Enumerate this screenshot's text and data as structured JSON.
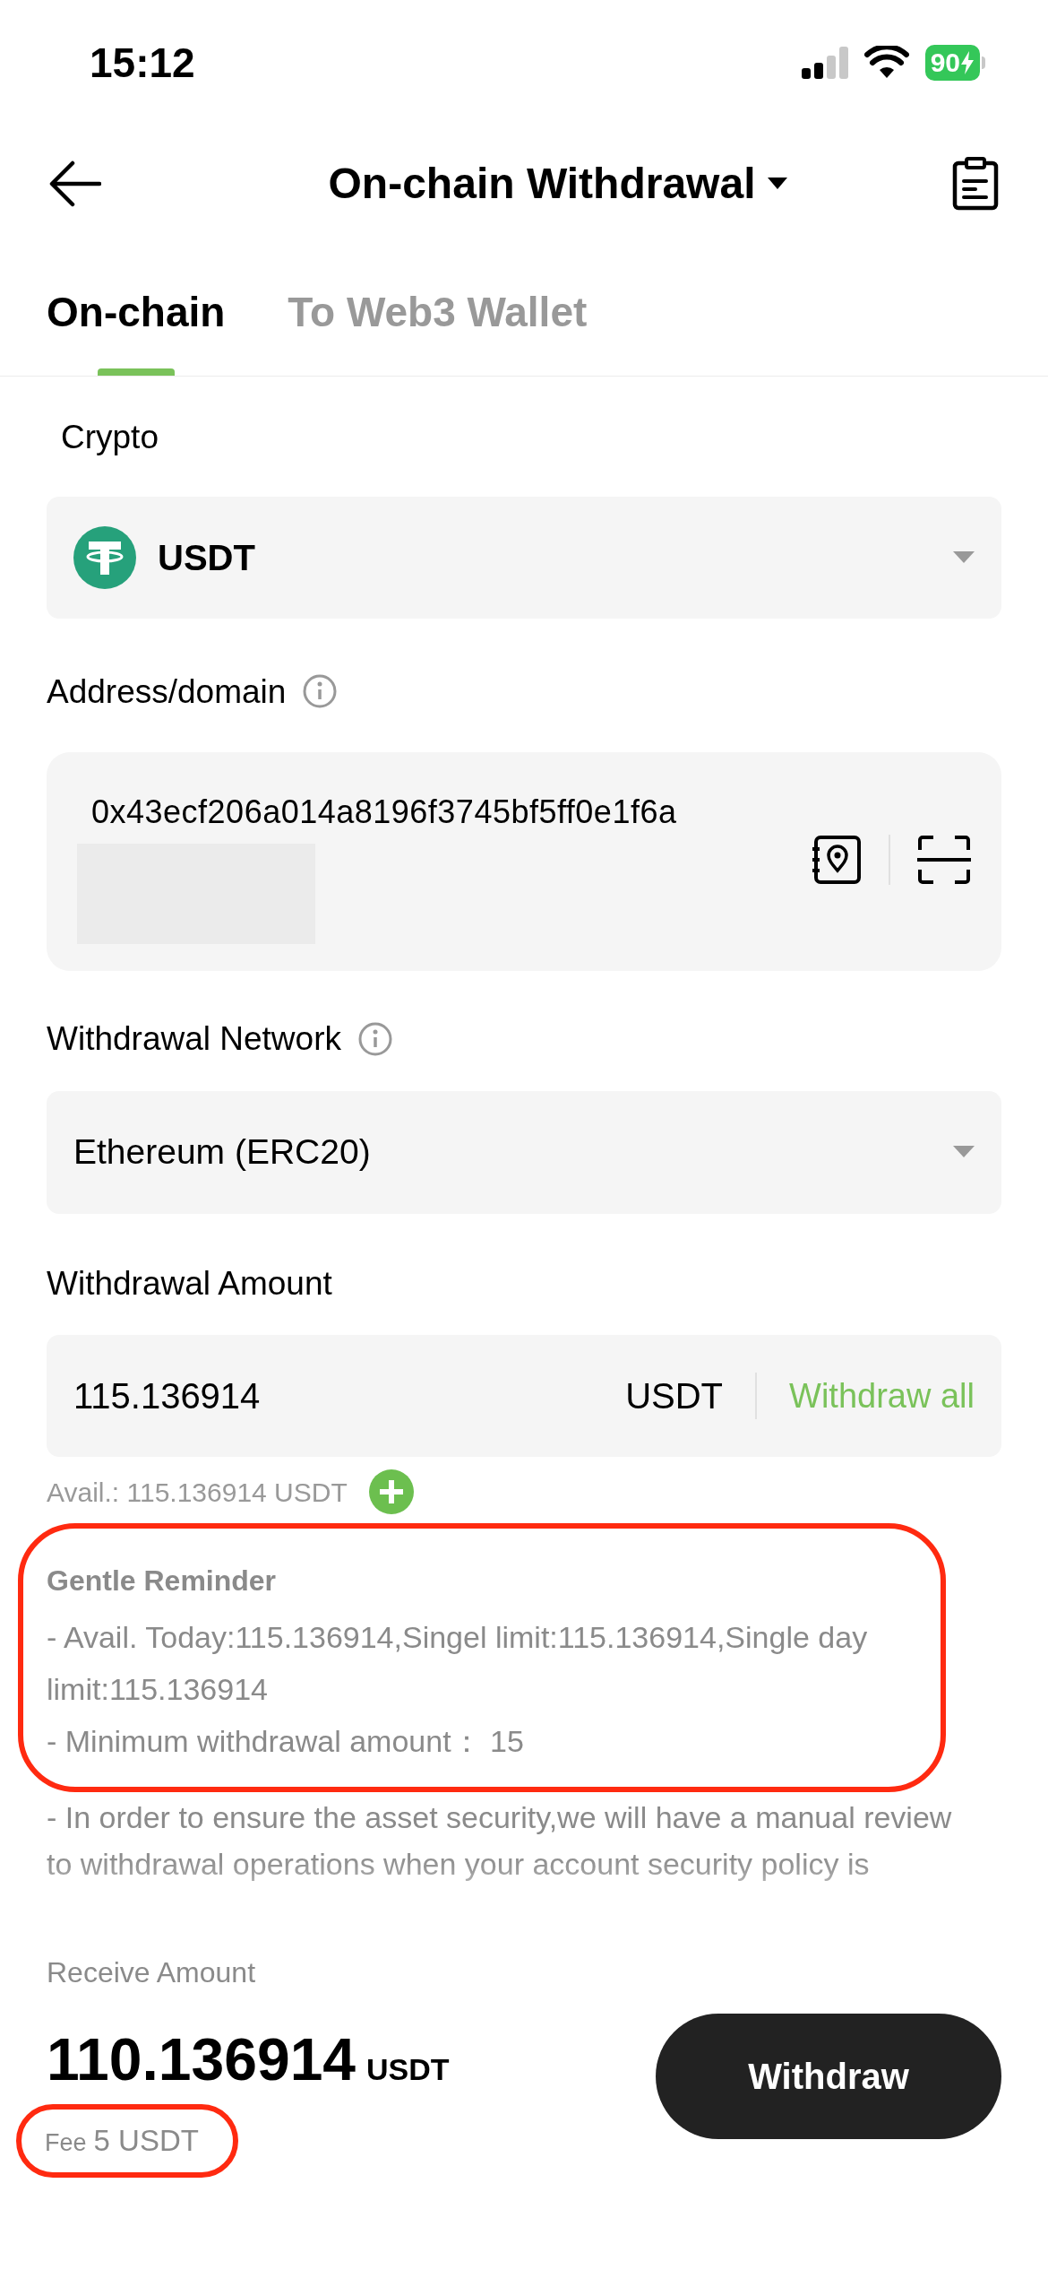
{
  "status_bar": {
    "time": "15:12",
    "battery": "90"
  },
  "header": {
    "title": "On-chain Withdrawal"
  },
  "tabs": [
    {
      "label": "On-chain",
      "selected": true
    },
    {
      "label": "To Web3 Wallet",
      "selected": false
    }
  ],
  "crypto": {
    "label": "Crypto",
    "value": "USDT"
  },
  "address": {
    "label": "Address/domain",
    "value": "0x43ecf206a014a8196f3745bf5ff0e1f6a"
  },
  "network": {
    "label": "Withdrawal Network",
    "value": "Ethereum (ERC20)"
  },
  "amount": {
    "label": "Withdrawal Amount",
    "value": "115.136914",
    "unit": "USDT",
    "action": "Withdraw all",
    "available": "Avail.: 115.136914 USDT"
  },
  "reminder": {
    "title": "Gentle Reminder",
    "lines": [
      "- Avail. Today:115.136914,Singel limit:115.136914,Single day limit:115.136914",
      "- Minimum withdrawal amount： 15"
    ],
    "note_lines": [
      "- In order to ensure the asset security,we will have a manual review",
      "to withdrawal operations when your account security policy is"
    ]
  },
  "receive": {
    "label": "Receive Amount",
    "amount": "110.136914",
    "unit": "USDT",
    "fee_label": "Fee",
    "fee": "5 USDT"
  },
  "button": "Withdraw"
}
